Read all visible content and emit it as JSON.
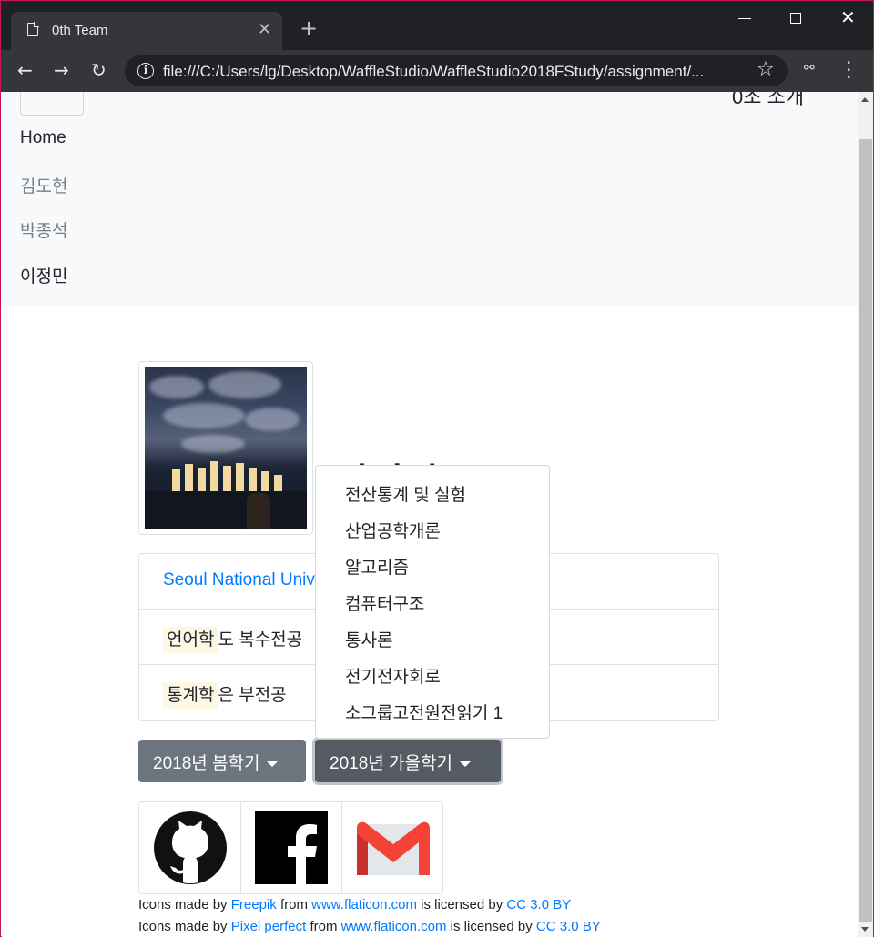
{
  "browser": {
    "tab_title": "0th Team",
    "url": "file:///C:/Users/lg/Desktop/WaffleStudio/WaffleStudio2018FStudy/assignment/..."
  },
  "navbar": {
    "brand": "0조 소개",
    "links": [
      {
        "label": "Home",
        "color": "#212529"
      },
      {
        "label": "김도현",
        "color": "#777f87"
      },
      {
        "label": "박종석",
        "color": "#777f87"
      },
      {
        "label": "이정민",
        "color": "#212529"
      }
    ]
  },
  "profile": {
    "name_heading": "이정민",
    "university": "Seoul National University",
    "major_line": {
      "highlight": "언어학",
      "rest": "도 복수전공"
    },
    "minor_line": {
      "highlight": "통계학",
      "rest": "은 부전공"
    }
  },
  "dropdowns": {
    "spring": {
      "label": "2018년 봄학기"
    },
    "fall": {
      "label": "2018년 가을학기",
      "items": [
        "전산통계 및 실험",
        "산업공학개론",
        "알고리즘",
        "컴퓨터구조",
        "통사론",
        "전기전자회로",
        "소그룹고전원전읽기 1"
      ]
    }
  },
  "icons": [
    "github-icon",
    "facebook-icon",
    "gmail-icon"
  ],
  "credits": [
    {
      "pre": "Icons made by",
      "author": "Freepik",
      "mid": "from",
      "site": "www.flaticon.com",
      "lic_pre": "is licensed by",
      "license": "CC 3.0 BY"
    },
    {
      "pre": "Icons made by",
      "author": "Pixel perfect",
      "mid": "from",
      "site": "www.flaticon.com",
      "lic_pre": "is licensed by",
      "license": "CC 3.0 BY"
    }
  ],
  "colors": {
    "link": "#007bff",
    "secondary_btn": "#6c757d",
    "highlight": "#fcf8e3"
  }
}
